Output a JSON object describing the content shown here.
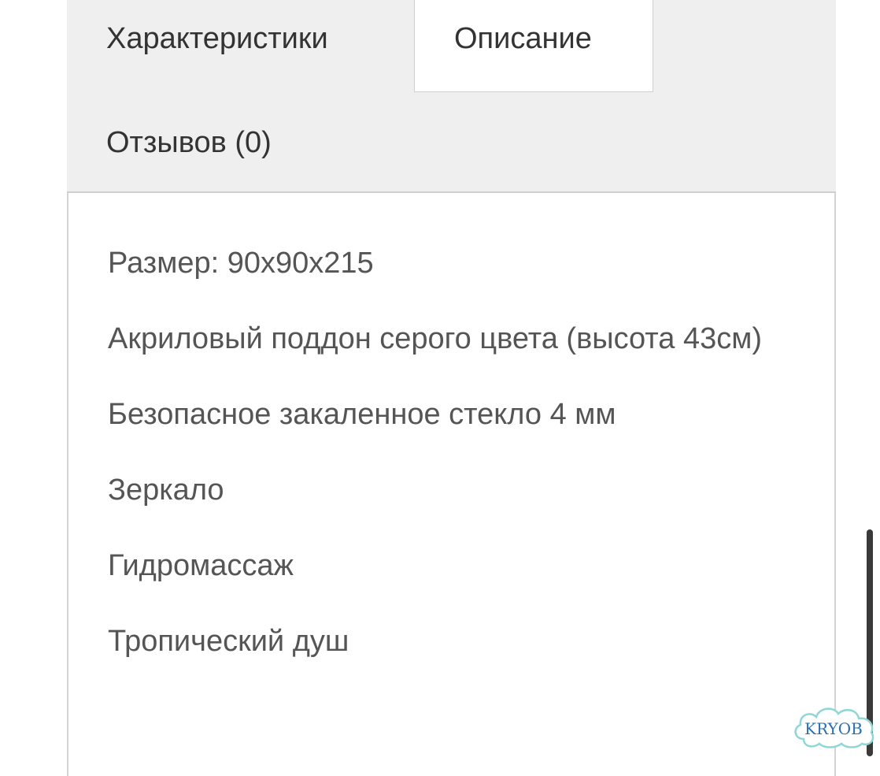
{
  "tabs": {
    "characteristics": "Характеристики",
    "description": "Описание",
    "reviews": "Отзывов (0)"
  },
  "description": {
    "items": [
      "Размер: 90x90x215",
      "Акриловый поддон серого цвета (высота 43см)",
      "Безопасное закаленное стекло 4 мм",
      "Зеркало",
      "Гидромассаж",
      "Тропический душ"
    ]
  },
  "watermark": {
    "text": "KRYOB"
  },
  "colors": {
    "tab_bar_bg": "#efefef",
    "active_tab_bg": "#ffffff",
    "tab_text": "#333333",
    "body_text": "#555555",
    "border": "#cfcfcf"
  }
}
